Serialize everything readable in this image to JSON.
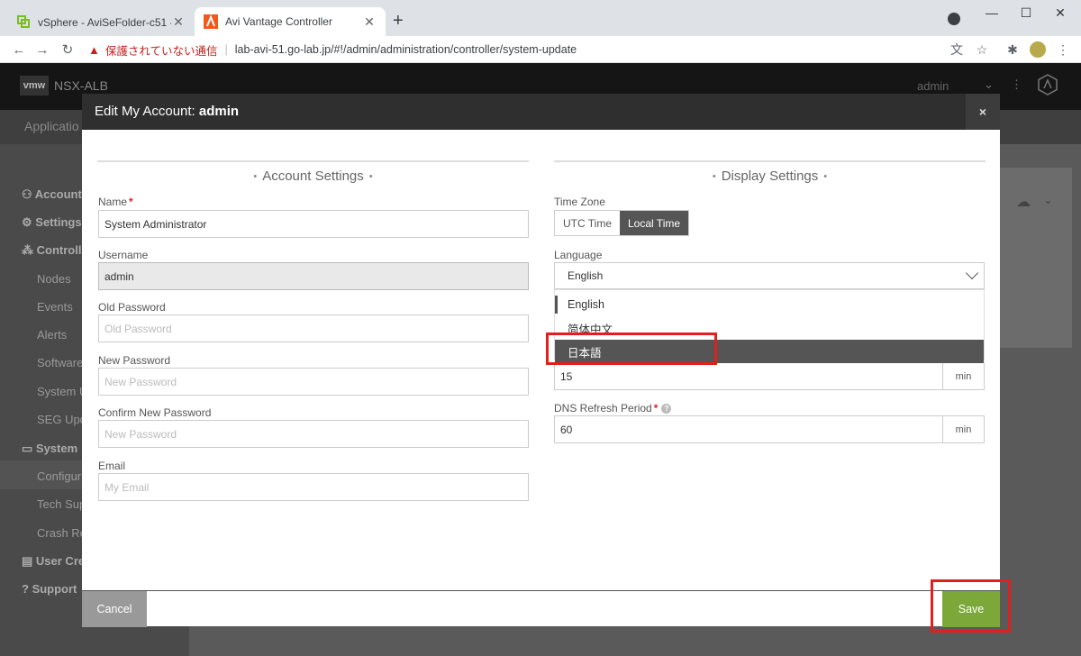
{
  "browser": {
    "tabs": [
      {
        "title": "vSphere - AviSeFolder-c51 - サマリ",
        "icon": "vsphere-icon",
        "active": false
      },
      {
        "title": "Avi Vantage Controller",
        "icon": "avi-icon",
        "active": true
      }
    ],
    "security_warning": "保護されていない通信",
    "url": "lab-avi-51.go-lab.jp/#!/admin/administration/controller/system-update"
  },
  "app": {
    "logo": "vmw",
    "product": "NSX-ALB",
    "user": "admin",
    "subnav": "Applicatio",
    "sidebar": [
      {
        "label": "Account",
        "bold": true,
        "icon": "person-icon"
      },
      {
        "label": "Settings",
        "bold": true,
        "icon": "gear-icon"
      },
      {
        "label": "Controller",
        "bold": true,
        "icon": "cluster-icon"
      },
      {
        "label": "Nodes",
        "bold": false
      },
      {
        "label": "Events",
        "bold": false
      },
      {
        "label": "Alerts",
        "bold": false
      },
      {
        "label": "Software",
        "bold": false
      },
      {
        "label": "System U",
        "bold": false
      },
      {
        "label": "SEG Upd",
        "bold": false
      },
      {
        "label": "System",
        "bold": true,
        "icon": "monitor-icon"
      },
      {
        "label": "Configur",
        "bold": false
      },
      {
        "label": "Tech Sup",
        "bold": false
      },
      {
        "label": "Crash Re",
        "bold": false
      },
      {
        "label": "User Cre",
        "bold": true,
        "icon": "doc-icon"
      },
      {
        "label": "Support",
        "bold": true,
        "icon": "help-icon"
      }
    ]
  },
  "modal": {
    "title_prefix": "Edit My Account: ",
    "title_user": "admin",
    "close": "×",
    "account_section": "Account Settings",
    "display_section": "Display Settings",
    "fields": {
      "name_label": "Name",
      "name_value": "System Administrator",
      "username_label": "Username",
      "username_value": "admin",
      "old_password_label": "Old Password",
      "old_password_placeholder": "Old Password",
      "new_password_label": "New Password",
      "new_password_placeholder": "New Password",
      "confirm_password_label": "Confirm New Password",
      "confirm_password_placeholder": "New Password",
      "email_label": "Email",
      "email_placeholder": "My Email"
    },
    "display": {
      "timezone_label": "Time Zone",
      "timezone_options": [
        "UTC Time",
        "Local Time"
      ],
      "timezone_selected": "Local Time",
      "language_label": "Language",
      "language_selected": "English",
      "language_options": [
        "English",
        "简体中文",
        "日本語"
      ],
      "language_highlighted": "日本語",
      "timeout_value": "15",
      "timeout_unit": "min",
      "dns_label": "DNS Refresh Period",
      "dns_value": "60",
      "dns_unit": "min"
    },
    "buttons": {
      "cancel": "Cancel",
      "save": "Save"
    }
  },
  "colors": {
    "save": "#7ca83a",
    "annotation": "#e0201c",
    "header": "#2f2f2f"
  }
}
